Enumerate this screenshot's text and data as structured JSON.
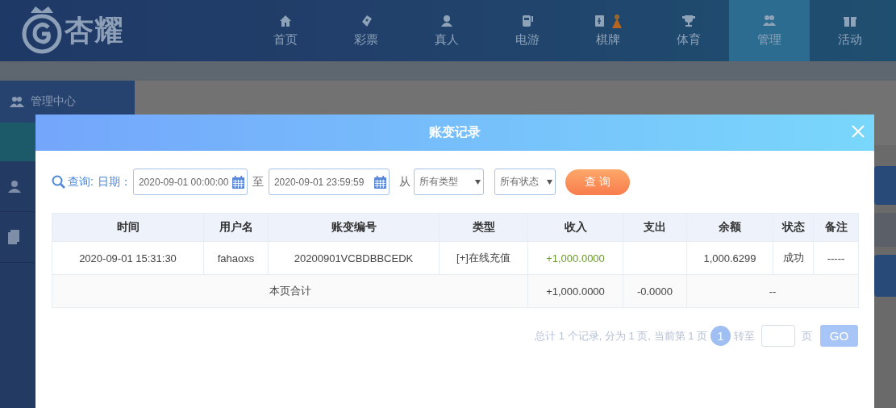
{
  "header": {
    "logo": "杏耀",
    "nav": [
      {
        "label": "首页",
        "selected": false
      },
      {
        "label": "彩票",
        "selected": false
      },
      {
        "label": "真人",
        "selected": false
      },
      {
        "label": "电游",
        "selected": false
      },
      {
        "label": "棋牌",
        "selected": false
      },
      {
        "label": "体育",
        "selected": false
      },
      {
        "label": "管理",
        "selected": true
      },
      {
        "label": "活动",
        "selected": false
      }
    ]
  },
  "sidebar": {
    "heading": "管理中心"
  },
  "dialog": {
    "title": "账变记录",
    "filters": {
      "query_label": "查询:",
      "date_label": "日期：",
      "start": "2020-09-01 00:00:00",
      "to": "至",
      "end": "2020-09-01 23:59:59",
      "from": "从",
      "type_select": "所有类型",
      "status_select": "所有状态",
      "search_button": "查 询"
    },
    "table": {
      "columns": [
        "时间",
        "用户名",
        "账变编号",
        "类型",
        "收入",
        "支出",
        "余额",
        "状态",
        "备注"
      ],
      "rows": [
        {
          "time": "2020-09-01 15:31:30",
          "user": "fahaoxs",
          "id": "20200901VCBDBBCEDK",
          "type": "[+]在线充值",
          "income": "+1,000.0000",
          "balance": "1,000.6299",
          "status": "成功",
          "note": "-----"
        }
      ],
      "total": {
        "label": "本页合计",
        "income": "+1,000.0000",
        "expense": "-0.0000",
        "rest": "--"
      }
    },
    "pager": {
      "summary": "总计 1 个记录, 分为 1 页, 当前第 1 页",
      "pages": [
        {
          "label": "1",
          "selected": true
        }
      ],
      "goto": "转至",
      "page_unit": "页",
      "go": "GO"
    }
  }
}
